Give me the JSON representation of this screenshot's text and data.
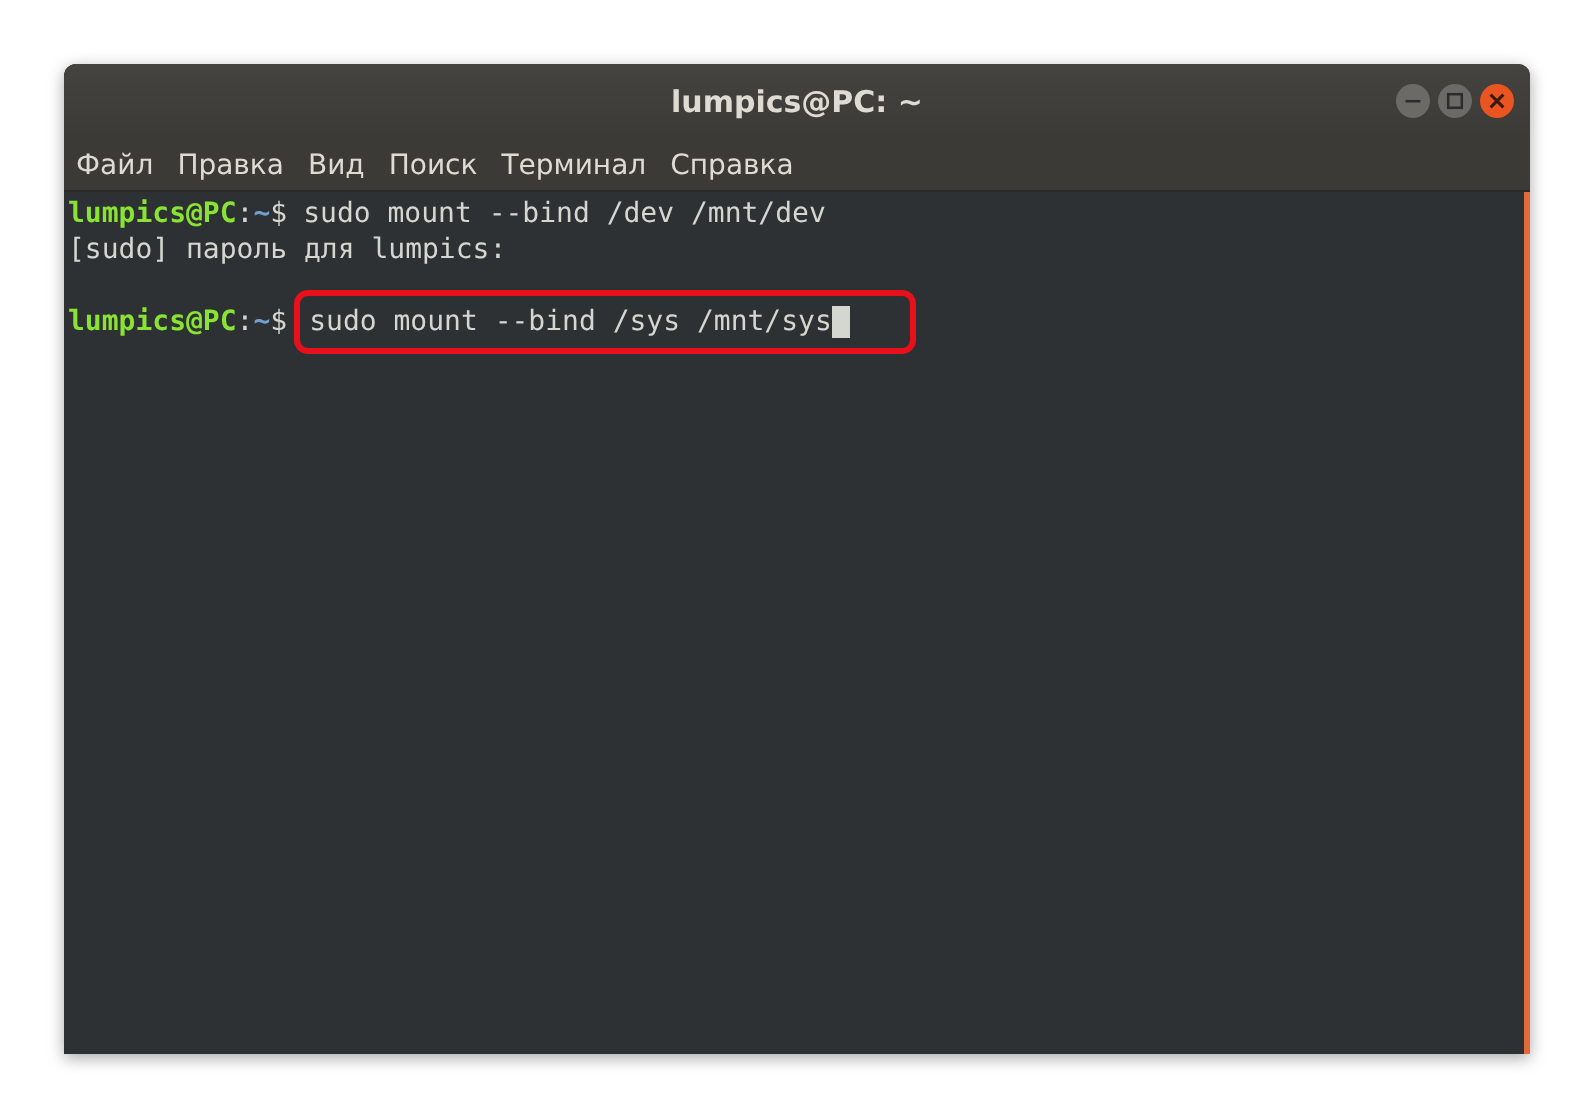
{
  "window": {
    "title": "lumpics@PC: ~"
  },
  "menu": [
    "Файл",
    "Правка",
    "Вид",
    "Поиск",
    "Терминал",
    "Справка"
  ],
  "lines": [
    {
      "kind": "prompt",
      "user_host": "lumpics@PC",
      "colon": ":",
      "path": "~",
      "symbol": "$",
      "command": "sudo mount --bind /dev /mnt/dev",
      "highlighted": false,
      "cursor": false
    },
    {
      "kind": "output",
      "text": "[sudo] пароль для lumpics:"
    },
    {
      "kind": "blank"
    },
    {
      "kind": "prompt",
      "user_host": "lumpics@PC",
      "colon": ":",
      "path": "~",
      "symbol": "$",
      "command": "sudo mount --bind /sys /mnt/sys",
      "highlighted": true,
      "cursor": true
    }
  ]
}
